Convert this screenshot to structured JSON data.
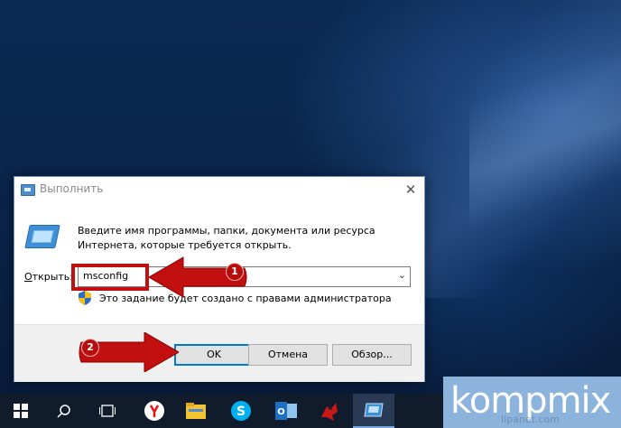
{
  "dialog": {
    "title": "Выполнить",
    "description": "Введите имя программы, папки, документа или ресурса Интернета, которые требуется открыть.",
    "open_label_underlined": "О",
    "open_label_rest": "ткрыть:",
    "command_value": "msconfig",
    "admin_note": "Это задание будет создано с правами администратора",
    "ok_label": "OK",
    "cancel_label": "Отмена",
    "browse_label": "Обзор...",
    "close_glyph": "✕"
  },
  "annotations": {
    "step1": "1",
    "step2": "2",
    "color": "#c21010"
  },
  "taskbar": {
    "items": [
      "windows-start",
      "search",
      "task-view",
      "yandex-browser",
      "file-explorer",
      "skype",
      "outlook",
      "game-app",
      "run-app"
    ]
  },
  "watermark": {
    "brand": "kompmix",
    "sub": "lipanet.com"
  }
}
